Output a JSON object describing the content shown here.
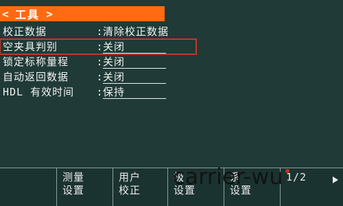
{
  "title_bar": {
    "left_chevron": "<",
    "title": "工具",
    "right_chevron": ">"
  },
  "menu": {
    "items": [
      {
        "label": "校正数据",
        "value": "清除校正数据",
        "underlined": false,
        "selected": false
      },
      {
        "label": "空夹具判别",
        "value": "关闭",
        "underlined": true,
        "selected": true
      },
      {
        "label": "锁定标称量程",
        "value": "关闭",
        "underlined": true,
        "selected": false
      },
      {
        "label": "自动返回数据",
        "value": "关闭",
        "underlined": true,
        "selected": false
      },
      {
        "label": "HDL 有效时间",
        "value": "保持",
        "underlined": true,
        "selected": false
      }
    ],
    "separator": ":"
  },
  "softkeys": [
    {
      "line1": "",
      "line2": ""
    },
    {
      "line1": "测量",
      "line2": "设置"
    },
    {
      "line1": "用户",
      "line2": "校正"
    },
    {
      "line1": "极",
      "line2": "设置"
    },
    {
      "line1": "系",
      "line2": "设置"
    },
    {
      "line1": "",
      "line2": "1/2"
    }
  ],
  "watermark": {
    "text": "carrier-wu"
  },
  "colors": {
    "screen_bg": "#1f3a37",
    "title_bar_bg": "#ff6a12",
    "selection_outline": "#c0392b",
    "text": "#f2f2f2"
  }
}
